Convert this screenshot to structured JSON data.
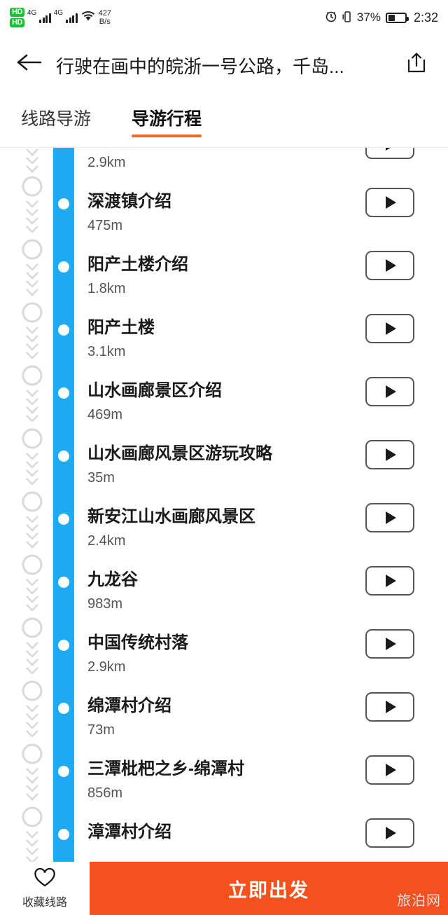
{
  "status_bar": {
    "hd_badge_1": "HD",
    "hd_badge_2": "HD",
    "net_1": "4G",
    "net_2": "4G",
    "wifi_icon": "wifi-icon",
    "data_rate_value": "427",
    "data_rate_unit": "B/s",
    "alarm_icon": "alarm-icon",
    "vibrate_icon": "vibrate-icon",
    "battery_percent": "37%",
    "clock": "2:32"
  },
  "app_bar": {
    "back_icon": "back-arrow-icon",
    "title": "行驶在画中的皖浙一号公路，千岛...",
    "share_icon": "share-icon"
  },
  "tabs": [
    {
      "label": "线路导游",
      "active": false
    },
    {
      "label": "导游行程",
      "active": true
    }
  ],
  "itinerary": {
    "partial_top": {
      "distance": "2.9km",
      "play_icon": "play-icon"
    },
    "items": [
      {
        "name": "深渡镇介绍",
        "distance": "475m",
        "play_icon": "play-icon"
      },
      {
        "name": "阳产土楼介绍",
        "distance": "1.8km",
        "play_icon": "play-icon"
      },
      {
        "name": "阳产土楼",
        "distance": "3.1km",
        "play_icon": "play-icon"
      },
      {
        "name": "山水画廊景区介绍",
        "distance": "469m",
        "play_icon": "play-icon"
      },
      {
        "name": "山水画廊风景区游玩攻略",
        "distance": "35m",
        "play_icon": "play-icon"
      },
      {
        "name": "新安江山水画廊风景区",
        "distance": "2.4km",
        "play_icon": "play-icon"
      },
      {
        "name": "九龙谷",
        "distance": "983m",
        "play_icon": "play-icon"
      },
      {
        "name": "中国传统村落",
        "distance": "2.9km",
        "play_icon": "play-icon"
      },
      {
        "name": "绵潭村介绍",
        "distance": "73m",
        "play_icon": "play-icon"
      },
      {
        "name": "三潭枇杷之乡-绵潭村",
        "distance": "856m",
        "play_icon": "play-icon"
      },
      {
        "name": "漳潭村介绍",
        "distance": "",
        "play_icon": "play-icon"
      }
    ]
  },
  "bottom_bar": {
    "favorite_icon": "heart-icon",
    "favorite_label": "收藏线路",
    "cta_label": "立即出发"
  },
  "watermark": "旅泊网",
  "colors": {
    "accent_blue": "#1eaaf0",
    "cta_orange": "#f4511e",
    "tab_underline": "#f26522",
    "hd_green": "#16c232"
  }
}
